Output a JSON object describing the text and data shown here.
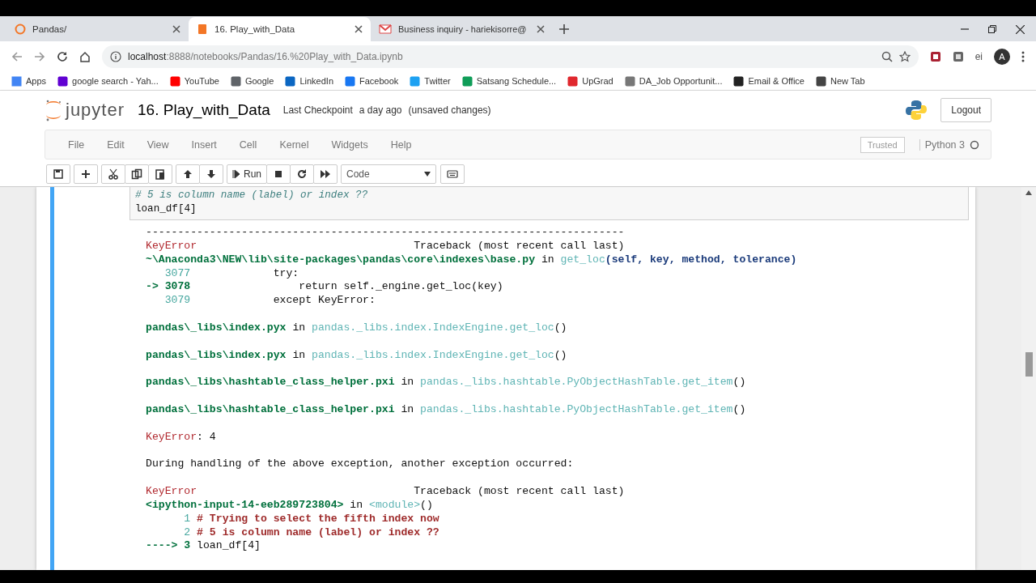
{
  "browser": {
    "tabs": [
      {
        "title": "Pandas/",
        "kind": "jupyter",
        "selected": false
      },
      {
        "title": "16. Play_with_Data",
        "kind": "notebook",
        "selected": true
      },
      {
        "title": "Business inquiry - hariekisorre@",
        "kind": "mail",
        "selected": false
      }
    ],
    "address": {
      "host": "localhost",
      "path": ":8888/notebooks/Pandas/16.%20Play_with_Data.ipynb"
    },
    "extension_label": "ei",
    "profile_initial": "A",
    "bookmarks": [
      {
        "label": "Apps",
        "color": "#4285f4"
      },
      {
        "label": "google search - Yah...",
        "color": "#6001d2"
      },
      {
        "label": "YouTube",
        "color": "#ff0000"
      },
      {
        "label": "Google",
        "color": "#5f6368"
      },
      {
        "label": "LinkedIn",
        "color": "#0a66c2"
      },
      {
        "label": "Facebook",
        "color": "#1877f2"
      },
      {
        "label": "Twitter",
        "color": "#1da1f2"
      },
      {
        "label": "Satsang Schedule...",
        "color": "#0f9d58"
      },
      {
        "label": "UpGrad",
        "color": "#e0282e"
      },
      {
        "label": "DA_Job Opportunit...",
        "color": "#777777"
      },
      {
        "label": "Email & Office",
        "color": "#222222"
      },
      {
        "label": "New Tab",
        "color": "#444444"
      }
    ]
  },
  "notebook": {
    "logo_text": "jupyter",
    "title": "16. Play_with_Data",
    "checkpoint_label": "Last Checkpoint",
    "checkpoint_time": "a day ago",
    "save_state": "(unsaved changes)",
    "logout": "Logout",
    "menu": [
      "File",
      "Edit",
      "View",
      "Insert",
      "Cell",
      "Kernel",
      "Widgets",
      "Help"
    ],
    "trusted": "Trusted",
    "kernel": "Python 3",
    "toolbar": {
      "run": "Run",
      "cell_type": "Code"
    }
  },
  "cell": {
    "selected": true,
    "input": [
      {
        "text": "# 5 is column name (label) or index ??",
        "kind": "comment"
      },
      {
        "text": "loan_df[4]",
        "kind": "code"
      }
    ],
    "output": [
      {
        "kind": "line",
        "segments": [
          {
            "text": "---------------------------------------------------------------------------",
            "kind": "plain"
          }
        ]
      },
      {
        "kind": "line",
        "segments": [
          {
            "text": "KeyError",
            "kind": "error"
          },
          {
            "text": "                                  Traceback (most recent call last)",
            "kind": "plain"
          }
        ]
      },
      {
        "kind": "line",
        "segments": [
          {
            "text": "~\\Anaconda3\\NEW\\lib\\site-packages\\pandas\\core\\indexes\\base.py",
            "kind": "path"
          },
          {
            "text": " in ",
            "kind": "plain"
          },
          {
            "text": "get_loc",
            "kind": "function"
          },
          {
            "text": "(self, key, method, tolerance)",
            "kind": "args"
          }
        ]
      },
      {
        "kind": "line",
        "segments": [
          {
            "text": "   3077",
            "kind": "lineno"
          },
          {
            "text": "             try:",
            "kind": "plain"
          }
        ]
      },
      {
        "kind": "line",
        "segments": [
          {
            "text": "-> 3078",
            "kind": "arrow"
          },
          {
            "text": "                 return self._engine.get_loc(key)",
            "kind": "plain"
          }
        ]
      },
      {
        "kind": "line",
        "segments": [
          {
            "text": "   3079",
            "kind": "lineno"
          },
          {
            "text": "             except KeyError:",
            "kind": "plain"
          }
        ]
      },
      {
        "kind": "blank"
      },
      {
        "kind": "line",
        "segments": [
          {
            "text": "pandas\\_libs\\index.pyx",
            "kind": "path"
          },
          {
            "text": " in ",
            "kind": "plain"
          },
          {
            "text": "pandas._libs.index.IndexEngine.get_loc",
            "kind": "function"
          },
          {
            "text": "()",
            "kind": "plain"
          }
        ]
      },
      {
        "kind": "blank"
      },
      {
        "kind": "line",
        "segments": [
          {
            "text": "pandas\\_libs\\index.pyx",
            "kind": "path"
          },
          {
            "text": " in ",
            "kind": "plain"
          },
          {
            "text": "pandas._libs.index.IndexEngine.get_loc",
            "kind": "function"
          },
          {
            "text": "()",
            "kind": "plain"
          }
        ]
      },
      {
        "kind": "blank"
      },
      {
        "kind": "line",
        "segments": [
          {
            "text": "pandas\\_libs\\hashtable_class_helper.pxi",
            "kind": "path"
          },
          {
            "text": " in ",
            "kind": "plain"
          },
          {
            "text": "pandas._libs.hashtable.PyObjectHashTable.get_item",
            "kind": "function"
          },
          {
            "text": "()",
            "kind": "plain"
          }
        ]
      },
      {
        "kind": "blank"
      },
      {
        "kind": "line",
        "segments": [
          {
            "text": "pandas\\_libs\\hashtable_class_helper.pxi",
            "kind": "path"
          },
          {
            "text": " in ",
            "kind": "plain"
          },
          {
            "text": "pandas._libs.hashtable.PyObjectHashTable.get_item",
            "kind": "function"
          },
          {
            "text": "()",
            "kind": "plain"
          }
        ]
      },
      {
        "kind": "blank"
      },
      {
        "kind": "line",
        "segments": [
          {
            "text": "KeyError",
            "kind": "error"
          },
          {
            "text": ": 4",
            "kind": "plain"
          }
        ]
      },
      {
        "kind": "blank"
      },
      {
        "kind": "line",
        "segments": [
          {
            "text": "During handling of the above exception, another exception occurred:",
            "kind": "plain"
          }
        ]
      },
      {
        "kind": "blank"
      },
      {
        "kind": "line",
        "segments": [
          {
            "text": "KeyError",
            "kind": "error"
          },
          {
            "text": "                                  Traceback (most recent call last)",
            "kind": "plain"
          }
        ]
      },
      {
        "kind": "line",
        "segments": [
          {
            "text": "<ipython-input-14-eeb289723804>",
            "kind": "path"
          },
          {
            "text": " in ",
            "kind": "plain"
          },
          {
            "text": "<module>",
            "kind": "function"
          },
          {
            "text": "()",
            "kind": "plain"
          }
        ]
      },
      {
        "kind": "line",
        "segments": [
          {
            "text": "      1",
            "kind": "lineno"
          },
          {
            "text": " # Trying to select the fifth index now",
            "kind": "comment"
          }
        ]
      },
      {
        "kind": "line",
        "segments": [
          {
            "text": "      2",
            "kind": "lineno"
          },
          {
            "text": " # 5 is column name (label) or index ??",
            "kind": "comment"
          }
        ]
      },
      {
        "kind": "line",
        "segments": [
          {
            "text": "----> 3",
            "kind": "arrow"
          },
          {
            "text": " loan_df[4]",
            "kind": "plain"
          }
        ]
      }
    ]
  }
}
